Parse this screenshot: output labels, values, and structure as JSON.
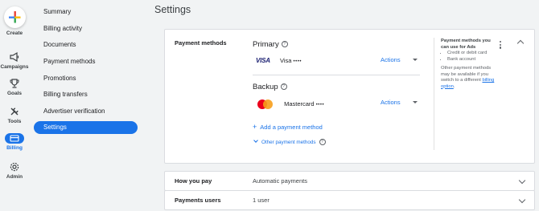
{
  "rail": {
    "create": "Create",
    "campaigns": "Campaigns",
    "goals": "Goals",
    "tools": "Tools",
    "billing": "Billing",
    "admin": "Admin"
  },
  "nav": {
    "items": [
      {
        "label": "Summary"
      },
      {
        "label": "Billing activity"
      },
      {
        "label": "Documents"
      },
      {
        "label": "Payment methods"
      },
      {
        "label": "Promotions"
      },
      {
        "label": "Billing transfers"
      },
      {
        "label": "Advertiser verification"
      },
      {
        "label": "Settings"
      }
    ],
    "active": "Settings"
  },
  "page": {
    "title": "Settings"
  },
  "payment_methods": {
    "heading": "Payment methods",
    "primary": {
      "title": "Primary",
      "brand": "VISA",
      "name": "Visa",
      "masked": "••••",
      "actions": "Actions"
    },
    "backup": {
      "title": "Backup",
      "name": "Mastercard",
      "masked": "••••",
      "actions": "Actions"
    },
    "add_label": "Add a payment method",
    "other_label": "Other payment methods",
    "side": {
      "title": "Payment methods you can use for Ads",
      "bullets": [
        "Credit or debit card",
        "Bank account"
      ],
      "note": "Other payment methods may be available if you switch to a different",
      "link": "billing option",
      "period": "."
    }
  },
  "rows": [
    {
      "label": "How you pay",
      "value": "Automatic payments"
    },
    {
      "label": "Payments users",
      "value": "1 user"
    }
  ],
  "colors": {
    "accent": "#1a73e8",
    "visa": "#1a1f71",
    "mc_red": "#eb001b",
    "mc_orange": "#f79e1b"
  }
}
